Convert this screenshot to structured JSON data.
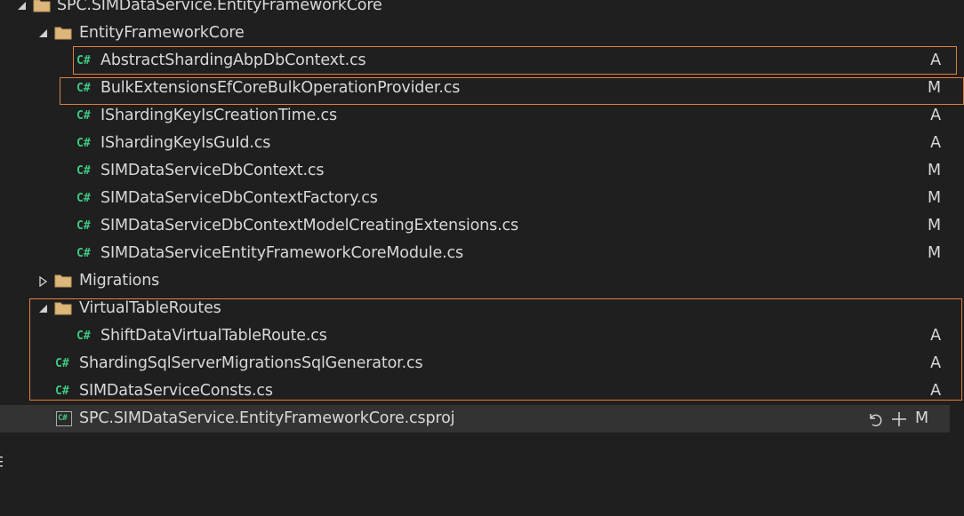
{
  "tree": {
    "root_project_folder": "SPC.SIMDataService.EntityFrameworkCore",
    "items": [
      {
        "kind": "folder",
        "label": "EntityFrameworkCore",
        "expanded": true,
        "status": ""
      },
      {
        "kind": "cs",
        "label": "AbstractShardingAbpDbContext.cs",
        "status": "A"
      },
      {
        "kind": "cs",
        "label": "BulkExtensionsEfCoreBulkOperationProvider.cs",
        "status": "M"
      },
      {
        "kind": "cs",
        "label": "IShardingKeyIsCreationTime.cs",
        "status": "A"
      },
      {
        "kind": "cs",
        "label": "IShardingKeyIsGuId.cs",
        "status": "A"
      },
      {
        "kind": "cs",
        "label": "SIMDataServiceDbContext.cs",
        "status": "M"
      },
      {
        "kind": "cs",
        "label": "SIMDataServiceDbContextFactory.cs",
        "status": "M"
      },
      {
        "kind": "cs",
        "label": "SIMDataServiceDbContextModelCreatingExtensions.cs",
        "status": "M"
      },
      {
        "kind": "cs",
        "label": "SIMDataServiceEntityFrameworkCoreModule.cs",
        "status": "M"
      },
      {
        "kind": "folder",
        "label": "Migrations",
        "expanded": false,
        "status": ""
      },
      {
        "kind": "folder",
        "label": "VirtualTableRoutes",
        "expanded": true,
        "status": ""
      },
      {
        "kind": "cs",
        "label": "ShiftDataVirtualTableRoute.cs",
        "status": "A"
      },
      {
        "kind": "cs",
        "label": "ShardingSqlServerMigrationsSqlGenerator.cs",
        "status": "A"
      },
      {
        "kind": "cs",
        "label": "SIMDataServiceConsts.cs",
        "status": "A"
      },
      {
        "kind": "csproj",
        "label": "SPC.SIMDataService.EntityFrameworkCore.csproj",
        "status": "M"
      }
    ]
  },
  "icons": {
    "cs_glyph": "C#",
    "proj_glyph": "C#",
    "undo": "undo-icon",
    "stage": "plus-icon",
    "expand_open": "triangle-down-icon",
    "expand_closed": "triangle-right-icon",
    "folder": "folder-icon"
  },
  "colors": {
    "background": "#1f1f1f",
    "selected_row": "#333333",
    "text": "#d8d8d8",
    "csharp_green": "#3fc882",
    "folder_tan": "#dcb67a",
    "highlight_orange": "#e2803a"
  }
}
